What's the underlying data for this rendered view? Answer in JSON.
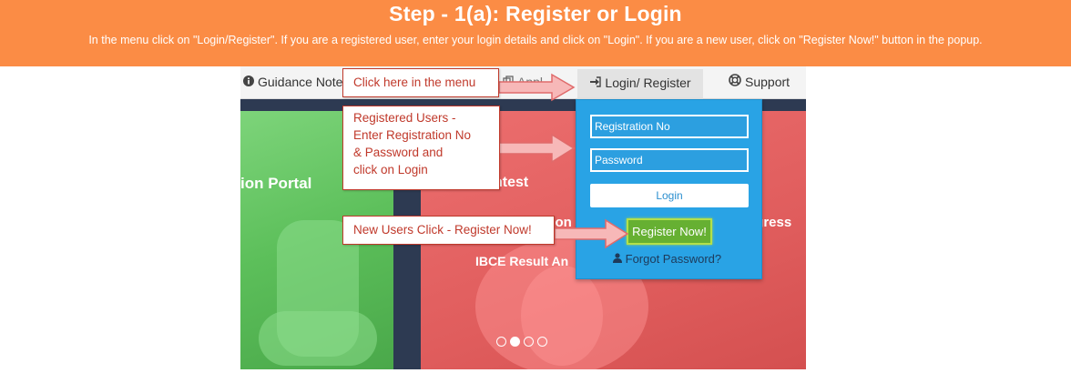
{
  "banner": {
    "title": "Step - 1(a): Register or Login",
    "description": "In the menu click on \"Login/Register\". If you are a registered user, enter your login details and click on \"Login\". If you are a new user, click on \"Register Now!\" button in the popup."
  },
  "navbar": {
    "guidance_label": "Guidance Notes",
    "apply_label": "Appl",
    "login_label": "Login/ Register",
    "support_label": "Support"
  },
  "slides": {
    "green_title": "ion Portal",
    "red_line1": "ntest",
    "red_line2": "Correction",
    "red_line3": "ogress",
    "red_line4": "IBCE Result  An"
  },
  "login_panel": {
    "registration_placeholder": "Registration No",
    "password_placeholder": "Password",
    "login_button": "Login",
    "register_button": "Register Now!",
    "forgot_link": "Forgot Password?"
  },
  "annotations": {
    "menu_hint": "Click here in the menu",
    "registered_hint": "Registered Users -\nEnter Registration No\n& Password and\nclick on Login",
    "new_user_hint": "New Users Click - Register Now!"
  },
  "carousel": {
    "slide_count": 4,
    "active_index": 1
  },
  "colors": {
    "banner": "#fb8c45",
    "dropdown": "#29a3e5",
    "register_button": "#66b032",
    "annotation": "#c0392b",
    "slide_green": "#5cbf5a",
    "slide_red": "#e05d5d"
  },
  "icons": {
    "guidance": "info-circle-icon",
    "apply": "copy-icon",
    "login": "sign-in-icon",
    "support": "lifebuoy-icon",
    "forgot": "user-icon"
  }
}
